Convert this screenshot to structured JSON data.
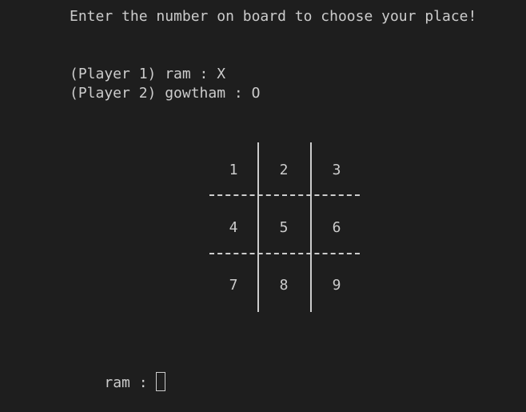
{
  "theme": {
    "background": "#1e1e1e",
    "foreground": "#cccccc"
  },
  "terminal": {
    "instruction": "Enter the number on board to choose your place!",
    "player1": "(Player 1) ram : X",
    "player2": "(Player 2) gowtham : O",
    "board": [
      "1",
      "2",
      "3",
      "4",
      "5",
      "6",
      "7",
      "8",
      "9"
    ],
    "prompt": "ram : "
  }
}
